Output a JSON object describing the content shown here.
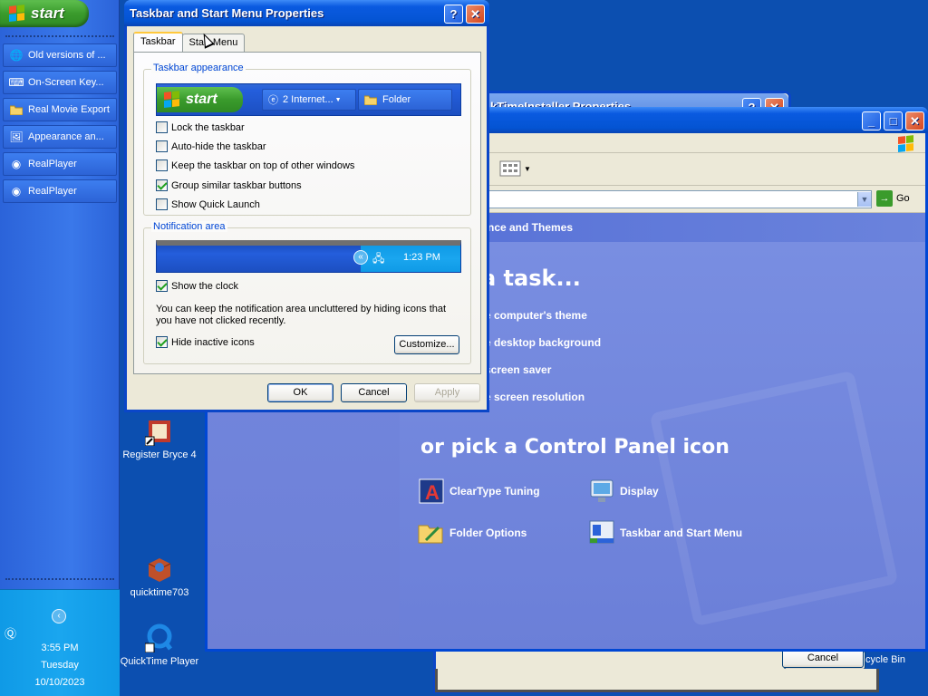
{
  "taskbar": {
    "start_label": "start",
    "items": [
      {
        "label": "Old versions of ...",
        "icon": "ie-icon"
      },
      {
        "label": "On-Screen Key...",
        "icon": "keyboard-icon"
      },
      {
        "label": "Real Movie Export",
        "icon": "folder-icon"
      },
      {
        "label": "Appearance an...",
        "icon": "control-panel-icon"
      },
      {
        "label": "RealPlayer",
        "icon": "realplayer-icon"
      },
      {
        "label": "RealPlayer",
        "icon": "realplayer-icon"
      }
    ],
    "tray": {
      "time": "3:55 PM",
      "day": "Tuesday",
      "date": "10/10/2023"
    }
  },
  "desktop_icons": [
    {
      "label": "Register Bryce 4"
    },
    {
      "label": "quicktime703"
    },
    {
      "label": "QuickTime Player"
    },
    {
      "label": "cycle Bin"
    }
  ],
  "background_window": {
    "title": "kTimeInstaller Properties",
    "cancel_label": "Cancel"
  },
  "control_panel": {
    "go_label": "Go",
    "crumb": "nce and Themes",
    "heading": "a task...",
    "tasks": [
      "e computer's theme",
      "e desktop background",
      "screen saver",
      "e screen resolution"
    ],
    "pick_heading": "or pick a Control Panel icon",
    "icons": [
      {
        "label": "ClearType Tuning",
        "icon": "cleartype-icon"
      },
      {
        "label": "Display",
        "icon": "display-icon"
      },
      {
        "label": "Folder Options",
        "icon": "folder-options-icon"
      },
      {
        "label": "Taskbar and Start Menu",
        "icon": "taskbar-icon"
      }
    ]
  },
  "dialog": {
    "title": "Taskbar and Start Menu Properties",
    "help_btn": "?",
    "close_btn": "✕",
    "tabs": [
      "Taskbar",
      "Start Menu"
    ],
    "appearance_group": "Taskbar appearance",
    "preview": {
      "start": "start",
      "button1": "2 Internet...",
      "button2": "Folder"
    },
    "appearance_options": [
      {
        "label": "Lock the taskbar",
        "checked": false
      },
      {
        "label": "Auto-hide the taskbar",
        "checked": false
      },
      {
        "label": "Keep the taskbar on top of other windows",
        "checked": false
      },
      {
        "label": "Group similar taskbar buttons",
        "checked": true
      },
      {
        "label": "Show Quick Launch",
        "checked": false
      }
    ],
    "notification_group": "Notification area",
    "notif_time": "1:23 PM",
    "show_clock": {
      "label": "Show the clock",
      "checked": true
    },
    "note": "You can keep the notification area uncluttered by hiding icons that you have not clicked recently.",
    "hide_inactive": {
      "label": "Hide inactive icons",
      "checked": true
    },
    "customize": "Customize...",
    "ok": "OK",
    "cancel": "Cancel",
    "apply": "Apply"
  },
  "colors": {
    "xp_blue": "#0054e3",
    "start_green": "#3a9b2c",
    "tray_blue": "#0f9ae6",
    "dialog_bg": "#ece9d8"
  }
}
